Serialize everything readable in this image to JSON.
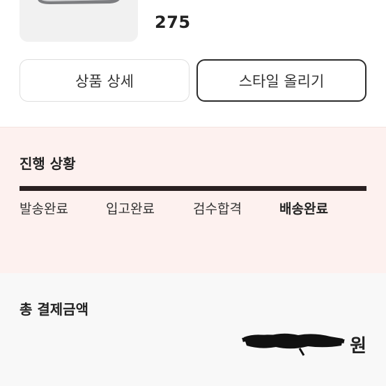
{
  "product": {
    "size": "275",
    "image_icon": "sneaker-image"
  },
  "buttons": {
    "detail_label": "상품 상세",
    "style_label": "스타일 올리기"
  },
  "progress": {
    "title": "진행 상황",
    "bar_fill": 1.0,
    "steps": [
      "발송완료",
      "입고완료",
      "검수합격",
      "배송완료"
    ],
    "active_step": "배송완료"
  },
  "total": {
    "title": "총 결제금액",
    "amount_suffix": "원"
  },
  "colors": {
    "progress_bg": "#fdf1ef",
    "bar": "#2a2021",
    "total_bg": "#f8f8f8",
    "redaction": "#111111"
  }
}
